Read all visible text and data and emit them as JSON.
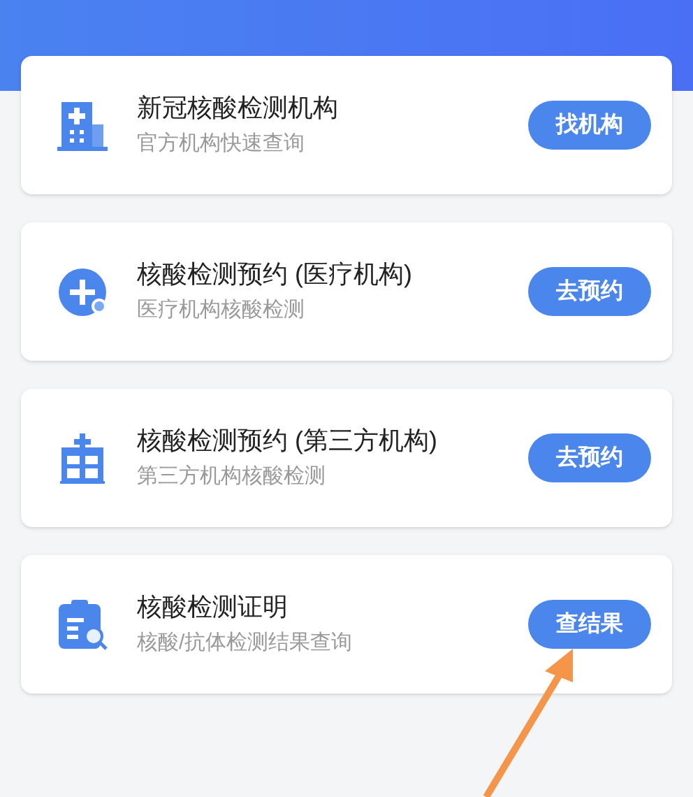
{
  "services": [
    {
      "kind": "building",
      "title": "新冠核酸检测机构",
      "subtitle": "官方机构快速查询",
      "button": "找机构"
    },
    {
      "kind": "plus",
      "title": "核酸检测预约 (医疗机构)",
      "subtitle": "医疗机构核酸检测",
      "button": "去预约"
    },
    {
      "kind": "clinic",
      "title": "核酸检测预约 (第三方机构)",
      "subtitle": "第三方机构核酸检测",
      "button": "去预约"
    },
    {
      "kind": "report",
      "title": "核酸检测证明",
      "subtitle": "核酸/抗体检测结果查询",
      "button": "查结果"
    }
  ]
}
